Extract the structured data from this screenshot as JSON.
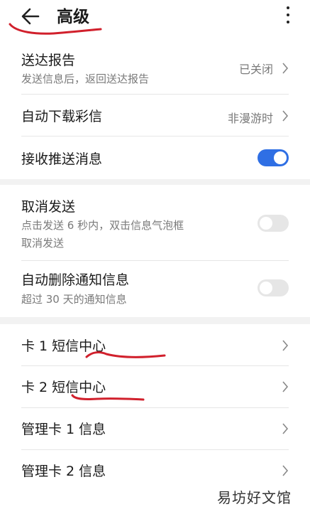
{
  "header": {
    "title": "高级"
  },
  "colors": {
    "accent": "#2f6fe4",
    "annotation": "#d1202c"
  },
  "group1": {
    "items": [
      {
        "label": "送达报告",
        "sub": "发送信息后，返回送达报告",
        "value": "已关闭"
      },
      {
        "label": "自动下载彩信",
        "value": "非漫游时"
      },
      {
        "label": "接收推送消息",
        "toggle": "on"
      }
    ]
  },
  "group2": {
    "items": [
      {
        "label": "取消发送",
        "sub1": "点击发送 6 秒内，双击信息气泡框",
        "sub2": "取消发送",
        "toggle": "off"
      },
      {
        "label": "自动删除通知信息",
        "sub": "超过 30 天的通知信息",
        "toggle": "off"
      }
    ]
  },
  "group3": {
    "items": [
      {
        "label": "卡 1 短信中心"
      },
      {
        "label": "卡 2 短信中心"
      },
      {
        "label": "管理卡 1 信息"
      },
      {
        "label": "管理卡 2 信息"
      }
    ]
  },
  "watermark": "易坊好文馆"
}
